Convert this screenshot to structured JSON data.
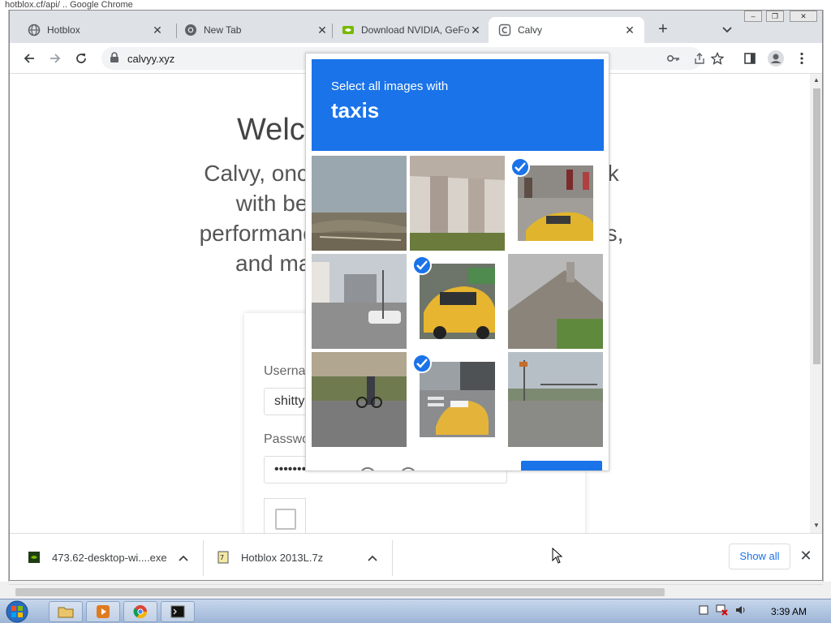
{
  "background_window": {
    "title_partial": "hotblox.cf/api/ .. Google Chrome"
  },
  "tabs": [
    {
      "label": "Hotblox",
      "icon": "globe-icon",
      "active": false
    },
    {
      "label": "New Tab",
      "icon": "chrome-icon",
      "active": false
    },
    {
      "label": "Download NVIDIA, GeFo",
      "icon": "nvidia-icon",
      "active": false
    },
    {
      "label": "Calvy",
      "icon": "calvy-icon",
      "active": true
    }
  ],
  "toolbar": {
    "url": "calvyy.xyz"
  },
  "page": {
    "welcome": "Welc",
    "intro_lines": [
      "Calvy, once a po                          ow back",
      "with better serv                      better",
      "performance, ur                             servers,",
      "and ma"
    ],
    "username_label": "Userna",
    "username_value": "shitty",
    "password_label": "Passwo",
    "password_value": "••••••••"
  },
  "captcha": {
    "line1": "Select all images with",
    "line2": "taxis",
    "tiles": [
      {
        "name": "overpass-road",
        "selected": false
      },
      {
        "name": "highway-pillars",
        "selected": false
      },
      {
        "name": "taxi-street",
        "selected": true
      },
      {
        "name": "city-intersection",
        "selected": false
      },
      {
        "name": "yellow-taxi",
        "selected": true
      },
      {
        "name": "house-roof",
        "selected": false
      },
      {
        "name": "cyclist-street",
        "selected": false
      },
      {
        "name": "taxi-crosswalk",
        "selected": true
      },
      {
        "name": "empty-intersection",
        "selected": false
      }
    ]
  },
  "downloads": [
    {
      "label": "473.62-desktop-wi....exe",
      "icon": "nvidia-file-icon"
    },
    {
      "label": "Hotblox 2013L.7z",
      "icon": "archive-file-icon"
    }
  ],
  "download_bar": {
    "show_all": "Show all"
  },
  "taskbar": {
    "clock": "3:39 AM"
  },
  "colors": {
    "accent": "#1a73e8",
    "tab_strip": "#dee1e6"
  }
}
